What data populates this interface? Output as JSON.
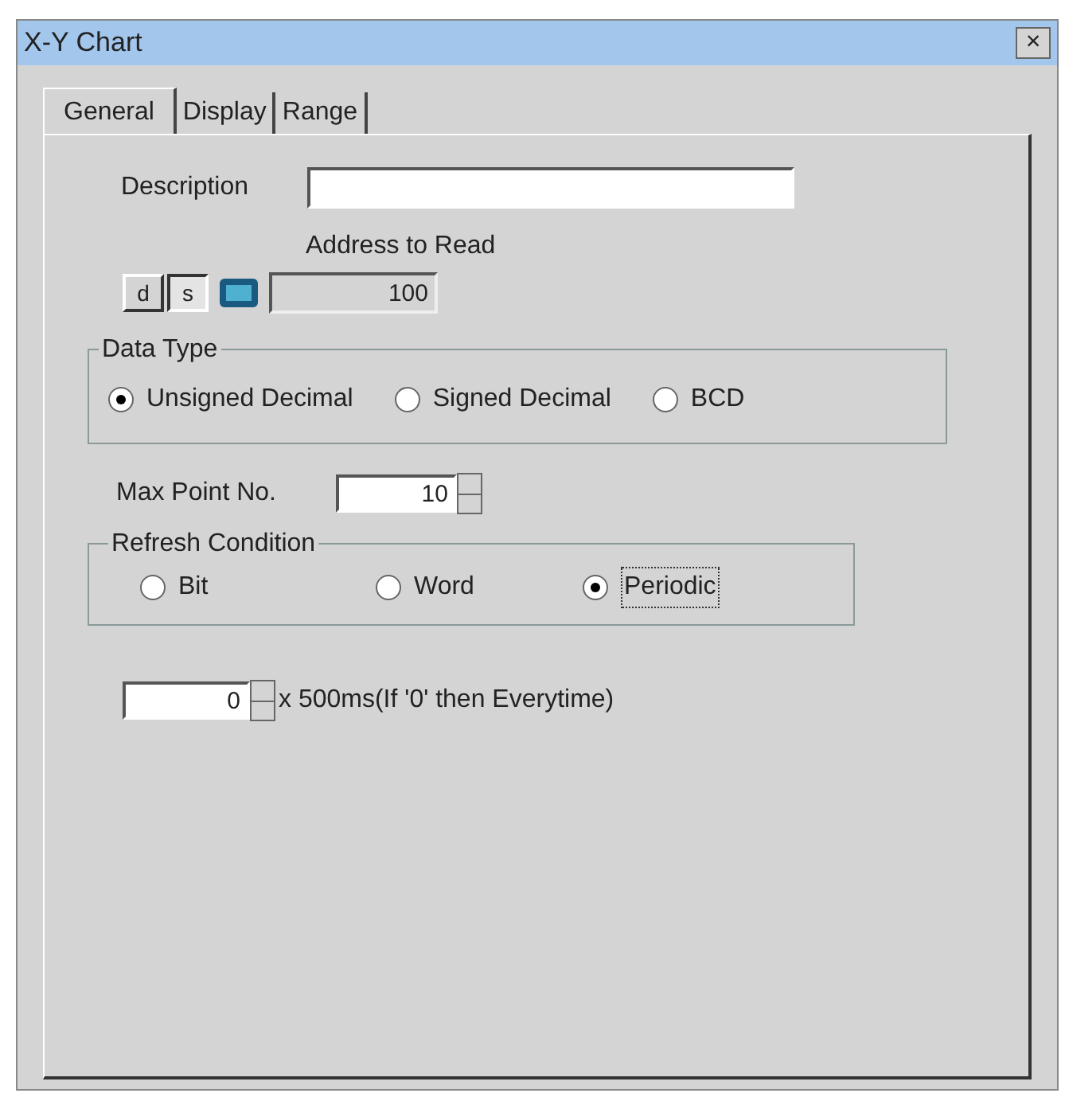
{
  "window": {
    "title": "X-Y Chart",
    "close": "×"
  },
  "tabs": [
    {
      "label": "General",
      "selected": true
    },
    {
      "label": "Display",
      "selected": false
    },
    {
      "label": "Range",
      "selected": false
    }
  ],
  "description": {
    "label": "Description"
  },
  "address": {
    "label": "Address to Read",
    "toggles": [
      {
        "label": "d",
        "selected": false
      },
      {
        "label": "s",
        "selected": true
      }
    ],
    "value": "100"
  },
  "data_type": {
    "title": "Data Type",
    "options": [
      {
        "label": "Unsigned Decimal",
        "selected": true
      },
      {
        "label": "Signed Decimal",
        "selected": false
      },
      {
        "label": "BCD",
        "selected": false
      }
    ]
  },
  "max_point": {
    "label": "Max Point No.",
    "value": "10"
  },
  "refresh": {
    "title": "Refresh Condition",
    "options": [
      {
        "label": "Bit",
        "selected": false
      },
      {
        "label": "Word",
        "selected": false
      },
      {
        "label": "Periodic",
        "selected": true
      }
    ]
  },
  "period": {
    "value": "0",
    "suffix": "x 500ms(If '0' then Everytime)"
  }
}
